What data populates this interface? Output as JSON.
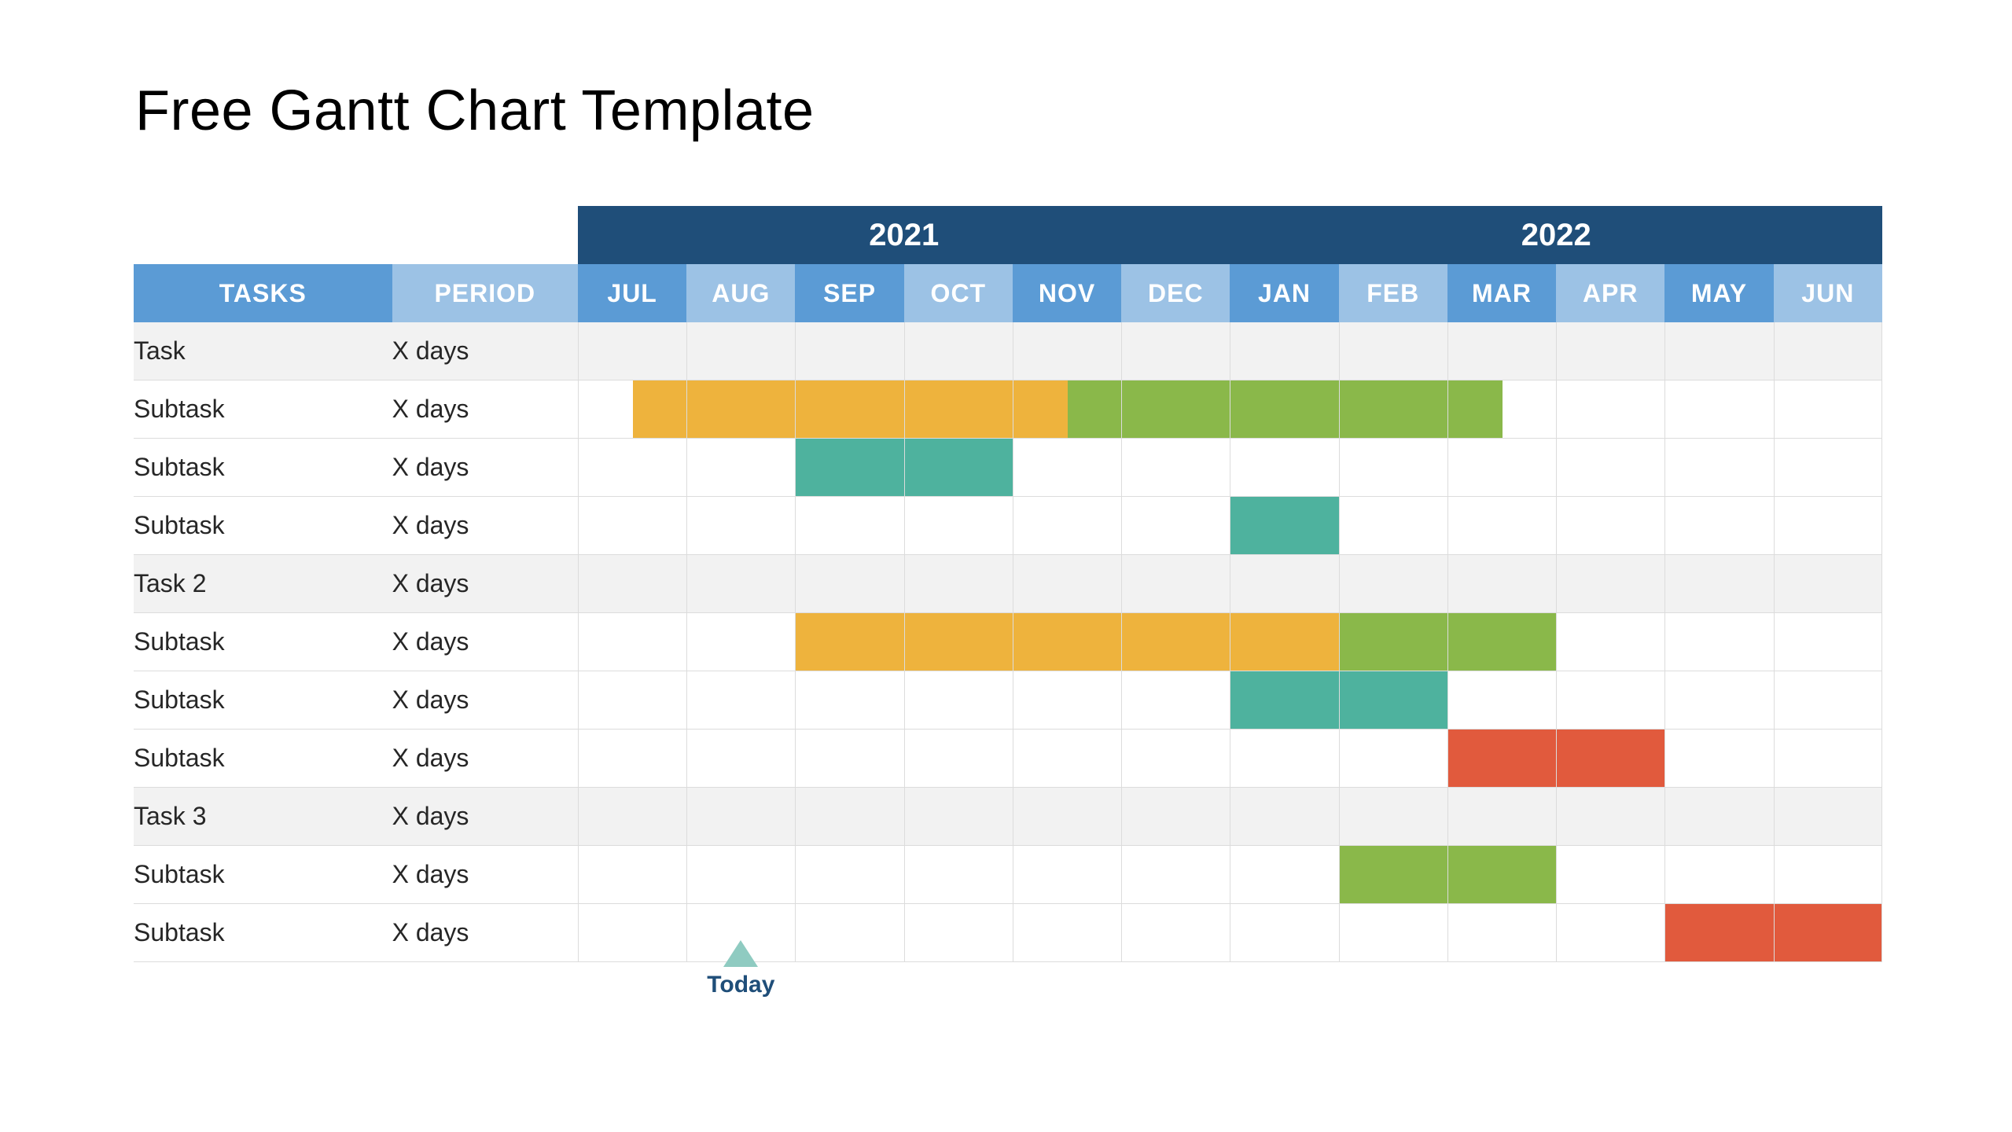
{
  "title": "Free Gantt Chart Template",
  "headers": {
    "tasks": "TASKS",
    "period": "PERIOD",
    "years": [
      "2021",
      "2022"
    ],
    "months": [
      "JUL",
      "AUG",
      "SEP",
      "OCT",
      "NOV",
      "DEC",
      "JAN",
      "FEB",
      "MAR",
      "APR",
      "MAY",
      "JUN"
    ]
  },
  "today": {
    "label": "Today",
    "month_index": 1.5
  },
  "colors": {
    "orange": "#eeb33d",
    "green": "#8ab84a",
    "teal": "#4eb29e",
    "red": "#e15a3d"
  },
  "rows": [
    {
      "label": "Task",
      "period": "X days",
      "group": true,
      "bars": []
    },
    {
      "label": "Subtask",
      "period": "X days",
      "group": false,
      "bars": [
        {
          "start": 0.5,
          "end": 4.5,
          "color": "orange"
        },
        {
          "start": 4.5,
          "end": 8.5,
          "color": "green"
        }
      ]
    },
    {
      "label": "Subtask",
      "period": "X days",
      "group": false,
      "bars": [
        {
          "start": 2,
          "end": 4,
          "color": "teal"
        }
      ]
    },
    {
      "label": "Subtask",
      "period": "X days",
      "group": false,
      "bars": [
        {
          "start": 6,
          "end": 7,
          "color": "teal"
        }
      ]
    },
    {
      "label": "Task 2",
      "period": "X days",
      "group": true,
      "bars": []
    },
    {
      "label": "Subtask",
      "period": "X days",
      "group": false,
      "bars": [
        {
          "start": 2,
          "end": 7,
          "color": "orange"
        },
        {
          "start": 7,
          "end": 9,
          "color": "green"
        }
      ]
    },
    {
      "label": "Subtask",
      "period": "X days",
      "group": false,
      "bars": [
        {
          "start": 6,
          "end": 8,
          "color": "teal"
        }
      ]
    },
    {
      "label": "Subtask",
      "period": "X days",
      "group": false,
      "bars": [
        {
          "start": 8,
          "end": 10,
          "color": "red"
        }
      ]
    },
    {
      "label": "Task 3",
      "period": "X days",
      "group": true,
      "bars": []
    },
    {
      "label": "Subtask",
      "period": "X days",
      "group": false,
      "bars": [
        {
          "start": 7,
          "end": 9,
          "color": "green"
        }
      ]
    },
    {
      "label": "Subtask",
      "period": "X days",
      "group": false,
      "bars": [
        {
          "start": 10,
          "end": 12,
          "color": "red"
        }
      ]
    }
  ],
  "chart_data": {
    "type": "gantt",
    "title": "Free Gantt Chart Template",
    "xlabel": "",
    "ylabel": "",
    "x_categories": [
      "2021-JUL",
      "2021-AUG",
      "2021-SEP",
      "2021-OCT",
      "2021-NOV",
      "2021-DEC",
      "2022-JAN",
      "2022-FEB",
      "2022-MAR",
      "2022-APR",
      "2022-MAY",
      "2022-JUN"
    ],
    "today_marker": 1.5,
    "series_colors": {
      "orange": "#eeb33d",
      "green": "#8ab84a",
      "teal": "#4eb29e",
      "red": "#e15a3d"
    },
    "tasks": [
      {
        "name": "Task",
        "period": "X days",
        "is_group": true,
        "segments": []
      },
      {
        "name": "Subtask",
        "period": "X days",
        "is_group": false,
        "segments": [
          {
            "start": 0.5,
            "end": 4.5,
            "color": "orange"
          },
          {
            "start": 4.5,
            "end": 8.5,
            "color": "green"
          }
        ]
      },
      {
        "name": "Subtask",
        "period": "X days",
        "is_group": false,
        "segments": [
          {
            "start": 2,
            "end": 4,
            "color": "teal"
          }
        ]
      },
      {
        "name": "Subtask",
        "period": "X days",
        "is_group": false,
        "segments": [
          {
            "start": 6,
            "end": 7,
            "color": "teal"
          }
        ]
      },
      {
        "name": "Task 2",
        "period": "X days",
        "is_group": true,
        "segments": []
      },
      {
        "name": "Subtask",
        "period": "X days",
        "is_group": false,
        "segments": [
          {
            "start": 2,
            "end": 7,
            "color": "orange"
          },
          {
            "start": 7,
            "end": 9,
            "color": "green"
          }
        ]
      },
      {
        "name": "Subtask",
        "period": "X days",
        "is_group": false,
        "segments": [
          {
            "start": 6,
            "end": 8,
            "color": "teal"
          }
        ]
      },
      {
        "name": "Subtask",
        "period": "X days",
        "is_group": false,
        "segments": [
          {
            "start": 8,
            "end": 10,
            "color": "red"
          }
        ]
      },
      {
        "name": "Task 3",
        "period": "X days",
        "is_group": true,
        "segments": []
      },
      {
        "name": "Subtask",
        "period": "X days",
        "is_group": false,
        "segments": [
          {
            "start": 7,
            "end": 9,
            "color": "green"
          }
        ]
      },
      {
        "name": "Subtask",
        "period": "X days",
        "is_group": false,
        "segments": [
          {
            "start": 10,
            "end": 12,
            "color": "red"
          }
        ]
      }
    ]
  }
}
